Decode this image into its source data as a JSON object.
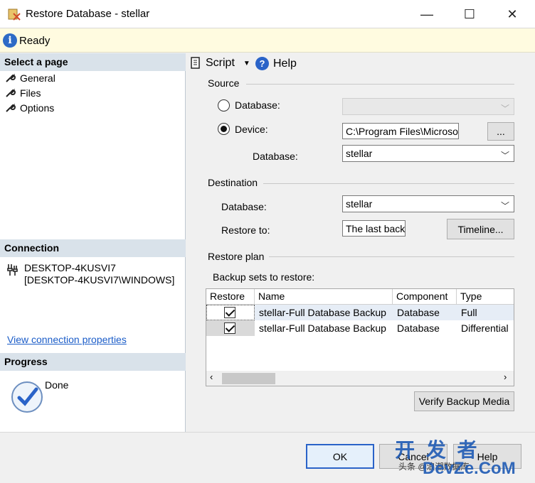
{
  "window": {
    "title": "Restore Database - stellar",
    "minimize": "—",
    "maximize": "☐",
    "close": "✕"
  },
  "status": {
    "text": "Ready"
  },
  "left": {
    "select_page_header": "Select a page",
    "pages": [
      {
        "label": "General"
      },
      {
        "label": "Files"
      },
      {
        "label": "Options"
      }
    ],
    "connection_header": "Connection",
    "connection_line1": "DESKTOP-4KUSVI7",
    "connection_line2": "[DESKTOP-4KUSVI7\\WINDOWS]",
    "view_connection_link": "View connection properties",
    "progress_header": "Progress",
    "progress_status": "Done"
  },
  "toolbar": {
    "script_label": "Script",
    "help_label": "Help"
  },
  "source": {
    "group_label": "Source",
    "database_radio_label": "Database:",
    "device_radio_label": "Device:",
    "device_path": "C:\\Program Files\\Microsof",
    "browse_label": "...",
    "database_label": "Database:",
    "database_value": "stellar",
    "selected": "device"
  },
  "destination": {
    "group_label": "Destination",
    "database_label": "Database:",
    "database_value": "stellar",
    "restore_to_label": "Restore to:",
    "restore_to_value": "The last back",
    "timeline_label": "Timeline..."
  },
  "restore_plan": {
    "group_label": "Restore plan",
    "backup_sets_label": "Backup sets to restore:",
    "columns": [
      "Restore",
      "Name",
      "Component",
      "Type"
    ],
    "rows": [
      {
        "restore": true,
        "name": "stellar-Full Database Backup",
        "component": "Database",
        "type": "Full"
      },
      {
        "restore": true,
        "name": "stellar-Full Database Backup",
        "component": "Database",
        "type": "Differential"
      }
    ],
    "verify_label": "Verify Backup Media"
  },
  "footer": {
    "ok_label": "OK",
    "cancel_label": "Cancel",
    "help_label": "Help"
  },
  "watermark": {
    "line1": "开 发 者",
    "line2": "DevZe.CoM",
    "line3": "头条 @浪潮数据库"
  }
}
